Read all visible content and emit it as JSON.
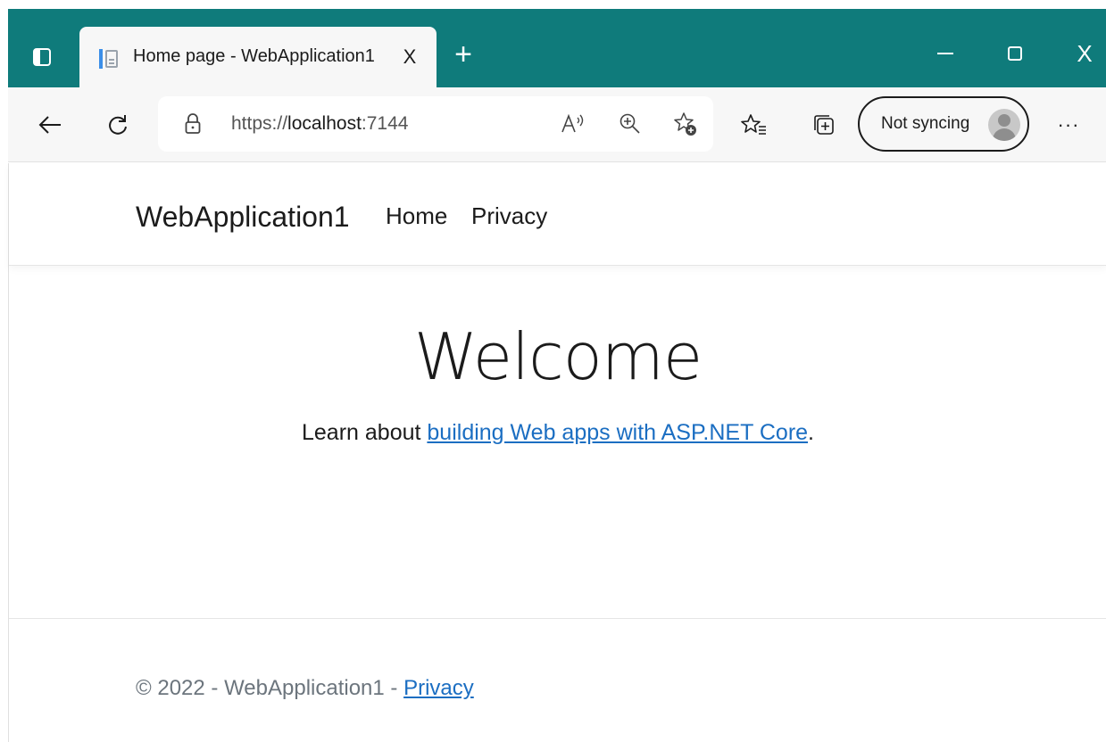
{
  "browser": {
    "tab": {
      "title": "Home page - WebApplication1",
      "close_glyph": "X"
    },
    "new_tab_glyph": "+",
    "window_controls": {
      "close_glyph": "X"
    },
    "address": {
      "scheme": "https://",
      "host": "localhost",
      "port": ":7144"
    },
    "profile": {
      "label": "Not syncing"
    },
    "more_glyph": "···",
    "colors": {
      "frame": "#0f7b7b",
      "toolbar": "#f7f7f7",
      "link": "#1b6ec2"
    }
  },
  "site": {
    "brand": "WebApplication1",
    "nav": {
      "home": "Home",
      "privacy": "Privacy"
    }
  },
  "main": {
    "heading": "Welcome",
    "learn_prefix": "Learn about ",
    "learn_link": "building Web apps with ASP.NET Core",
    "learn_suffix": "."
  },
  "footer": {
    "text": "© 2022 - WebApplication1 - ",
    "privacy_link": "Privacy"
  }
}
